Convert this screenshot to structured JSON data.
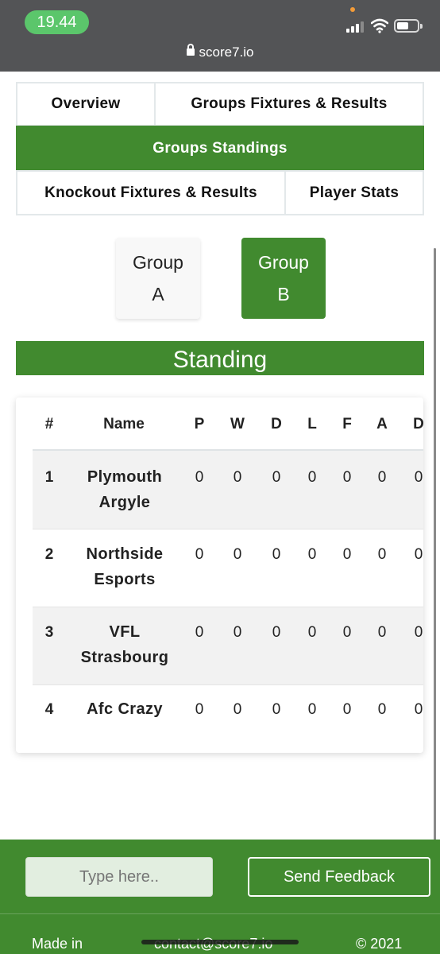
{
  "status_bar": {
    "time": "19.44"
  },
  "browser": {
    "url": "score7.io"
  },
  "tabs": {
    "overview": "Overview",
    "groups_fixtures": "Groups Fixtures & Results",
    "groups_standings": "Groups Standings",
    "knockout": "Knockout Fixtures & Results",
    "player_stats": "Player Stats"
  },
  "groups": {
    "a_word": "Group",
    "a_letter": "A",
    "b_word": "Group",
    "b_letter": "B",
    "selected": "B"
  },
  "standing": {
    "title": "Standing",
    "headers": [
      "#",
      "Name",
      "P",
      "W",
      "D",
      "L",
      "F",
      "A",
      "D"
    ],
    "rows": [
      {
        "rank": "1",
        "name_line1": "Plymouth",
        "name_line2": "Argyle",
        "p": "0",
        "w": "0",
        "d": "0",
        "l": "0",
        "f": "0",
        "a": "0",
        "gd": "0"
      },
      {
        "rank": "2",
        "name_line1": "Northside",
        "name_line2": "Esports",
        "p": "0",
        "w": "0",
        "d": "0",
        "l": "0",
        "f": "0",
        "a": "0",
        "gd": "0"
      },
      {
        "rank": "3",
        "name_line1": "VFL",
        "name_line2": "Strasbourg",
        "p": "0",
        "w": "0",
        "d": "0",
        "l": "0",
        "f": "0",
        "a": "0",
        "gd": "0"
      },
      {
        "rank": "4",
        "name_line1": "Afc Crazy",
        "name_line2": "",
        "p": "0",
        "w": "0",
        "d": "0",
        "l": "0",
        "f": "0",
        "a": "0",
        "gd": "0"
      }
    ]
  },
  "footer": {
    "input_placeholder": "Type here..",
    "send_label": "Send Feedback",
    "made_in": "Made in",
    "contact": "contact@score7.io",
    "copyright": "© 2021"
  },
  "colors": {
    "accent": "#418a2f",
    "time_pill": "#5bc66b"
  }
}
